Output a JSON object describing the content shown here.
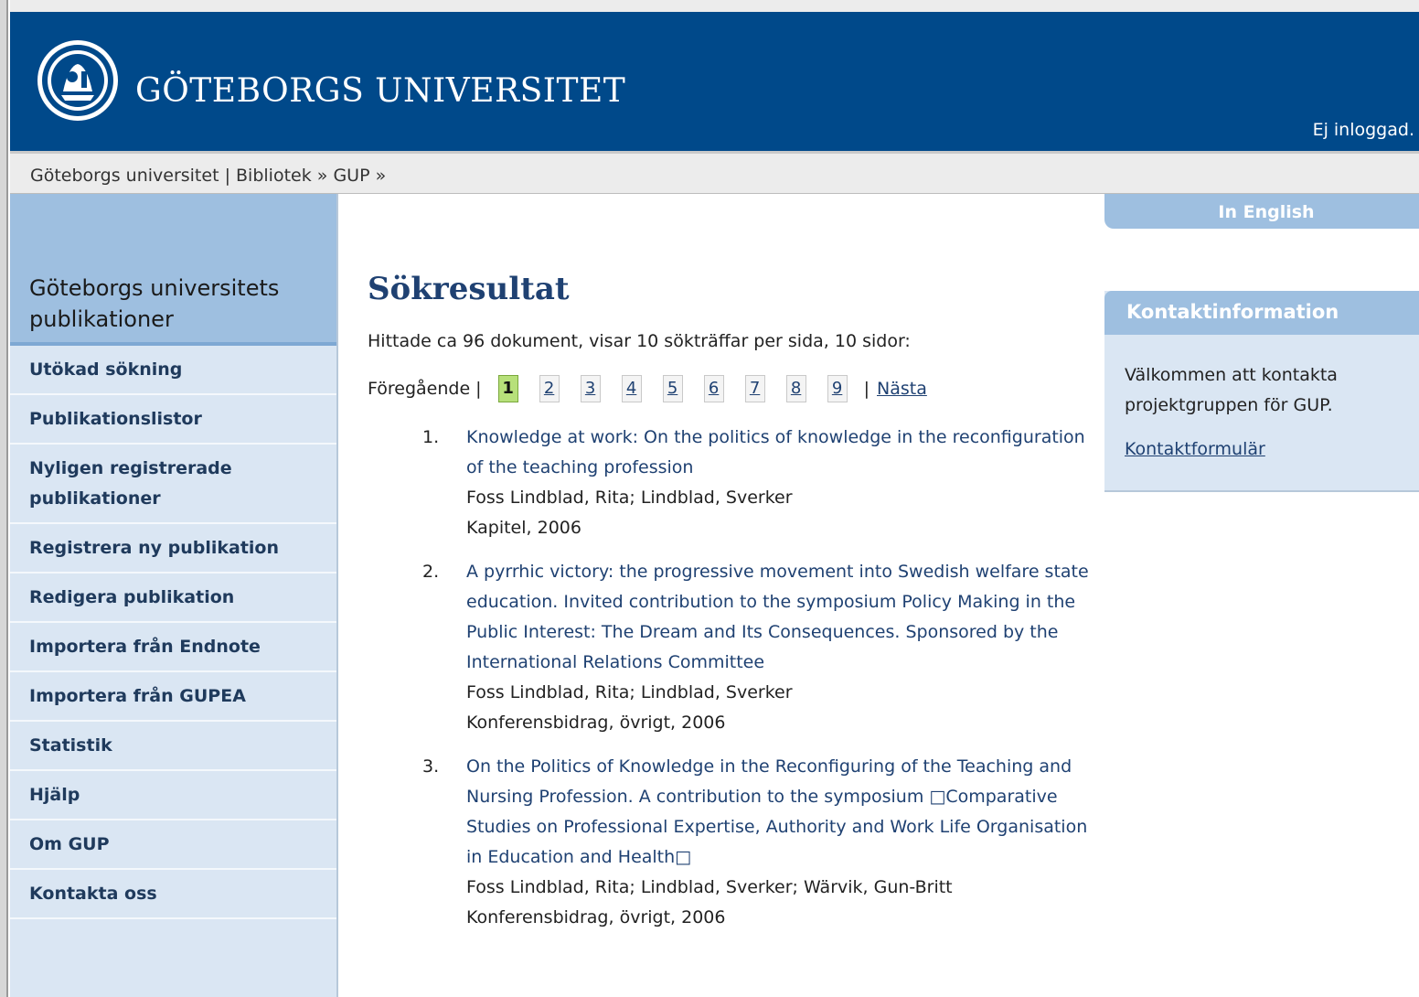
{
  "header": {
    "brand": "GÖTEBORGS UNIVERSITET",
    "login_status": "Ej inloggad."
  },
  "breadcrumb": {
    "items": [
      "Göteborgs universitet",
      "Bibliotek",
      "GUP"
    ],
    "sep1": " | ",
    "sep2": " » ",
    "sep3": " »"
  },
  "sidebar": {
    "title": "Göteborgs universitets publikationer",
    "items": [
      {
        "label": "Utökad sökning"
      },
      {
        "label": "Publikationslistor"
      },
      {
        "label": "Nyligen registrerade publikationer"
      },
      {
        "label": "Registrera ny publikation"
      },
      {
        "label": "Redigera publikation"
      },
      {
        "label": "Importera från Endnote"
      },
      {
        "label": "Importera från GUPEA"
      },
      {
        "label": "Statistik"
      },
      {
        "label": "Hjälp"
      },
      {
        "label": "Om GUP"
      },
      {
        "label": "Kontakta oss"
      }
    ]
  },
  "main": {
    "title": "Sökresultat",
    "summary": "Hittade ca 96 dokument, visar 10 sökträffar per sida, 10 sidor:",
    "pager": {
      "prev": "Föregående |",
      "pages": [
        "1",
        "2",
        "3",
        "4",
        "5",
        "6",
        "7",
        "8",
        "9"
      ],
      "current": "1",
      "sep": "|",
      "next": "Nästa"
    },
    "results": [
      {
        "num": "1.",
        "title": "Knowledge at work: On the politics of knowledge in the reconfiguration of the teaching profession",
        "authors": "Foss Lindblad, Rita; Lindblad, Sverker",
        "type": "Kapitel, 2006"
      },
      {
        "num": "2.",
        "title": "A pyrrhic victory: the progressive movement into Swedish welfare state education. Invited contribution to the symposium Policy Making in the Public Interest: The Dream and Its Consequences. Sponsored by the International Relations Committee",
        "authors": "Foss Lindblad, Rita; Lindblad, Sverker",
        "type": "Konferensbidrag, övrigt, 2006"
      },
      {
        "num": "3.",
        "title": "On the Politics of Knowledge in the Reconfiguring of the Teaching and Nursing Profession. A contribution to the symposium □Comparative Studies on Professional Expertise, Authority and Work Life Organisation in Education and Health□",
        "authors": "Foss Lindblad, Rita; Lindblad, Sverker; Wärvik, Gun-Britt",
        "type": "Konferensbidrag, övrigt, 2006"
      }
    ]
  },
  "rightcol": {
    "lang": "In English",
    "contact": {
      "heading": "Kontaktinformation",
      "text": "Välkommen att kontakta projektgruppen för GUP.",
      "link": "Kontaktformulär"
    }
  },
  "colors": {
    "header_bg": "#00498a",
    "sidebar_bg": "#dae6f3",
    "sidebar_head": "#9ebfe0",
    "link": "#1f4172",
    "current_page": "#b7e07a"
  }
}
